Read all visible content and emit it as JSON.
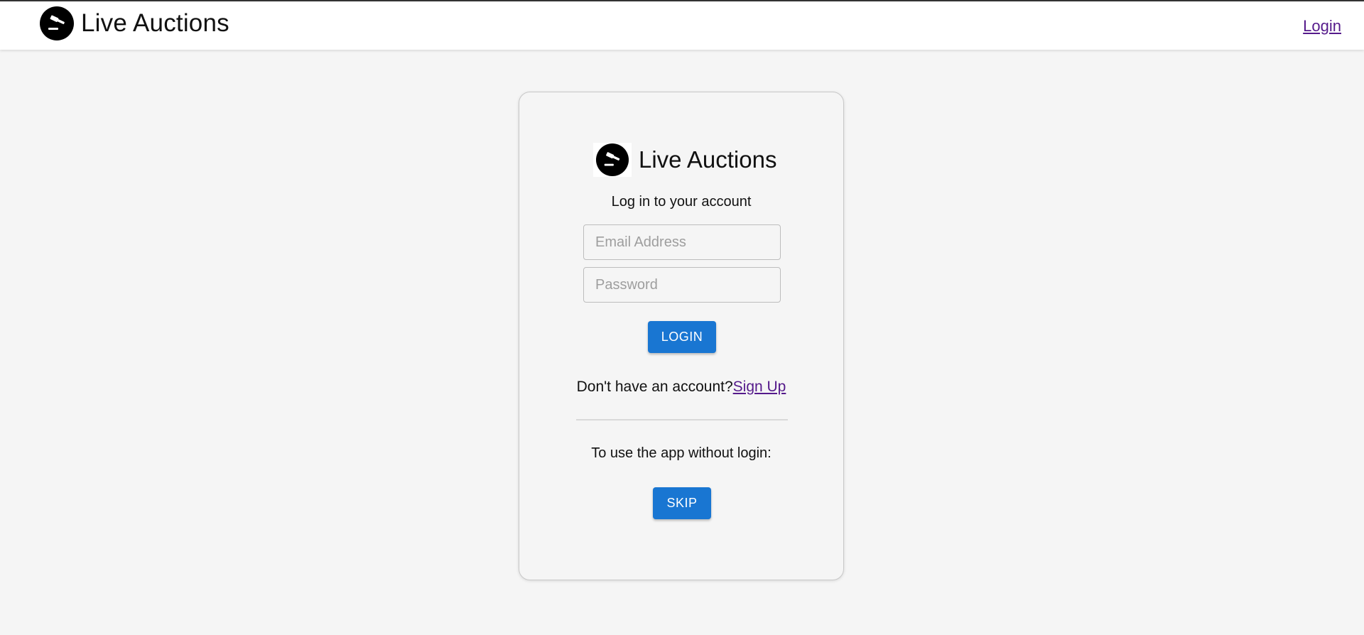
{
  "header": {
    "brand_title": "Live Auctions",
    "logo_icon": "gavel-icon",
    "login_link": "Login"
  },
  "card": {
    "brand_title": "Live Auctions",
    "logo_icon": "gavel-icon",
    "subtitle": "Log in to your account",
    "email": {
      "placeholder": "Email Address",
      "value": ""
    },
    "password": {
      "placeholder": "Password",
      "value": ""
    },
    "login_button": "LOGIN",
    "signup_prompt": "Don't have an account?",
    "signup_link": "Sign Up",
    "skip_prompt": "To use the app without login:",
    "skip_button": "SKIP"
  },
  "colors": {
    "primary": "#1976d2",
    "link_visited": "#551a8b",
    "background": "#f5f5f5"
  }
}
